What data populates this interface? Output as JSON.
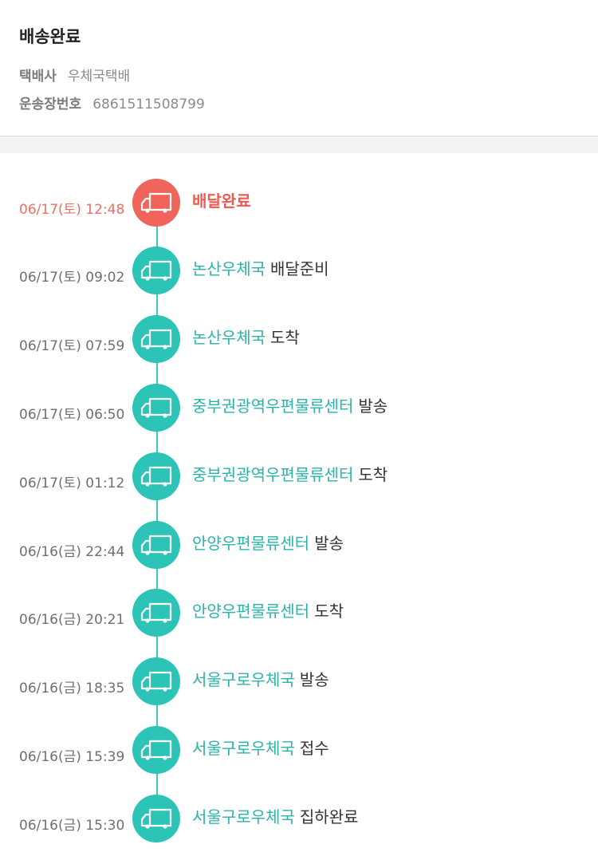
{
  "header": {
    "status": "배송완료",
    "courier_label": "택배사",
    "courier_value": "우체국택배",
    "tracking_label": "운송장번호",
    "tracking_value": "6861511508799"
  },
  "colors": {
    "accent_teal": "#2bc4b7",
    "accent_red": "#f0645c",
    "location_text": "#2ab3a8",
    "current_time_text": "#ec6f66"
  },
  "timeline": {
    "events": [
      {
        "time": "06/17(토) 12:48",
        "location": "",
        "action": "배달완료",
        "icon": "truck-icon",
        "current": true
      },
      {
        "time": "06/17(토) 09:02",
        "location": "논산우체국",
        "action": "배달준비",
        "icon": "truck-icon"
      },
      {
        "time": "06/17(토) 07:59",
        "location": "논산우체국",
        "action": "도착",
        "icon": "truck-icon"
      },
      {
        "time": "06/17(토) 06:50",
        "location": "중부권광역우편물류센터",
        "action": "발송",
        "icon": "truck-icon"
      },
      {
        "time": "06/17(토) 01:12",
        "location": "중부권광역우편물류센터",
        "action": "도착",
        "icon": "truck-icon"
      },
      {
        "time": "06/16(금) 22:44",
        "location": "안양우편물류센터",
        "action": "발송",
        "icon": "truck-icon"
      },
      {
        "time": "06/16(금) 20:21",
        "location": "안양우편물류센터",
        "action": "도착",
        "icon": "truck-icon"
      },
      {
        "time": "06/16(금) 18:35",
        "location": "서울구로우체국",
        "action": "발송",
        "icon": "truck-icon"
      },
      {
        "time": "06/16(금) 15:39",
        "location": "서울구로우체국",
        "action": "접수",
        "icon": "truck-icon"
      },
      {
        "time": "06/16(금) 15:30",
        "location": "서울구로우체국",
        "action": "집하완료",
        "icon": "truck-icon"
      }
    ]
  }
}
